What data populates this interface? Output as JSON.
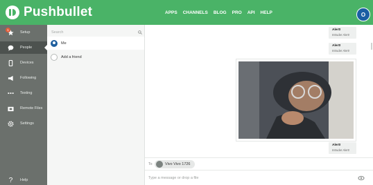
{
  "header": {
    "brand": "Pushbullet",
    "nav": [
      "APPS",
      "CHANNELS",
      "BLOG",
      "PRO",
      "API",
      "HELP"
    ],
    "account_initial": "O",
    "accent": "#4ab367"
  },
  "sidebar": {
    "badge_count": "1",
    "items": [
      {
        "label": "Setup",
        "icon": "star-icon"
      },
      {
        "label": "People",
        "icon": "chat-bubble-icon"
      },
      {
        "label": "Devices",
        "icon": "phone-icon"
      },
      {
        "label": "Following",
        "icon": "megaphone-icon"
      },
      {
        "label": "Texting",
        "icon": "sms-icon"
      },
      {
        "label": "Remote Files",
        "icon": "folder-icon"
      },
      {
        "label": "Settings",
        "icon": "gear-icon"
      }
    ],
    "help_label": "Help",
    "active_item": "People"
  },
  "people": {
    "search_placeholder": "Search",
    "contacts": [
      {
        "name": "Me",
        "selected": true
      },
      {
        "name": "Add a friend",
        "selected": false
      }
    ]
  },
  "conversation": {
    "messages": [
      {
        "title": "Alert!",
        "body": "Intruder Alert!"
      },
      {
        "title": "Alert!",
        "body": "Intruder Alert!"
      },
      {
        "title": "Alert!",
        "body": "Intruder Alert!"
      }
    ],
    "to_label": "To",
    "recipient": "Vivo Vivo 1726",
    "compose_placeholder": "Type a message or drop a file"
  }
}
